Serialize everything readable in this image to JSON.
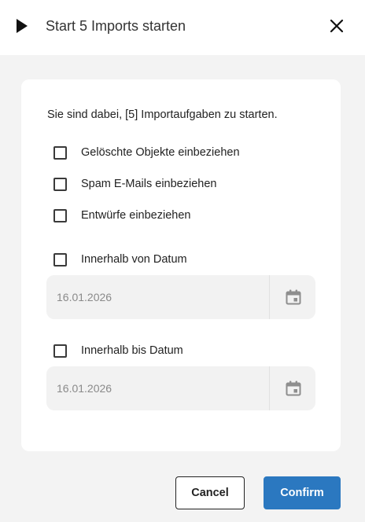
{
  "dialog": {
    "title": "Start 5 Imports starten",
    "play_icon": "play-icon",
    "close_icon": "close-icon"
  },
  "form": {
    "intro": "Sie sind dabei, [5] Importaufgaben zu starten.",
    "options": [
      {
        "label": "Gelöschte Objekte einbeziehen",
        "checked": false
      },
      {
        "label": "Spam E-Mails einbeziehen",
        "checked": false
      },
      {
        "label": "Entwürfe einbeziehen",
        "checked": false
      }
    ],
    "from_date": {
      "label": "Innerhalb von Datum",
      "checked": false,
      "value": "16.01.2026",
      "icon": "calendar-icon"
    },
    "to_date": {
      "label": "Innerhalb bis Datum",
      "checked": false,
      "value": "16.01.2026",
      "icon": "calendar-icon"
    }
  },
  "actions": {
    "cancel_label": "Cancel",
    "confirm_label": "Confirm"
  },
  "colors": {
    "accent": "#2b78c0",
    "background": "#f3f3f3",
    "card": "#ffffff",
    "field": "#f2f2f2"
  }
}
